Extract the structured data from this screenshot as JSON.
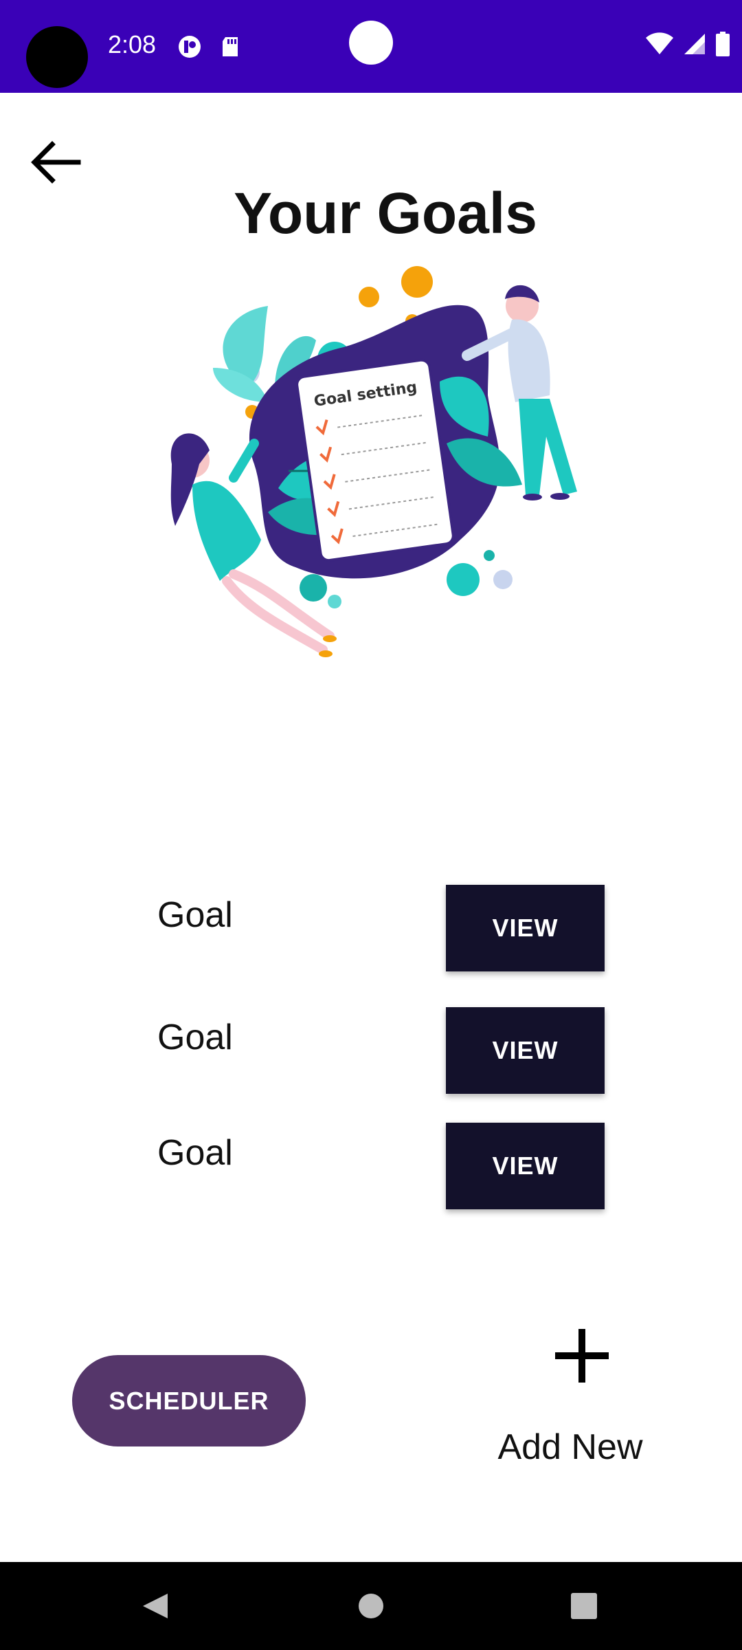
{
  "status_bar": {
    "time": "2:08",
    "icons": [
      "camera-hole",
      "app-notification-icon",
      "sd-card-icon",
      "wifi-icon",
      "signal-icon",
      "battery-icon"
    ]
  },
  "header": {
    "back_icon": "arrow-left-icon",
    "title": "Your Goals"
  },
  "illustration": {
    "caption": "Goal setting"
  },
  "goals": [
    {
      "label": "Goal",
      "button": "VIEW"
    },
    {
      "label": "Goal",
      "button": "VIEW"
    },
    {
      "label": "Goal",
      "button": "VIEW"
    }
  ],
  "actions": {
    "scheduler_label": "SCHEDULER",
    "add_new_label": "Add New",
    "add_icon": "plus-icon"
  },
  "nav_bar": {
    "icons": [
      "back-triangle-icon",
      "home-circle-icon",
      "recents-square-icon"
    ]
  },
  "colors": {
    "status_bar": "#3a01b7",
    "view_button": "#13112b",
    "scheduler_button": "#55366a",
    "illustration_blob": "#3b2580",
    "illustration_teal": "#1ec8c0",
    "illustration_orange": "#f5a20b"
  }
}
